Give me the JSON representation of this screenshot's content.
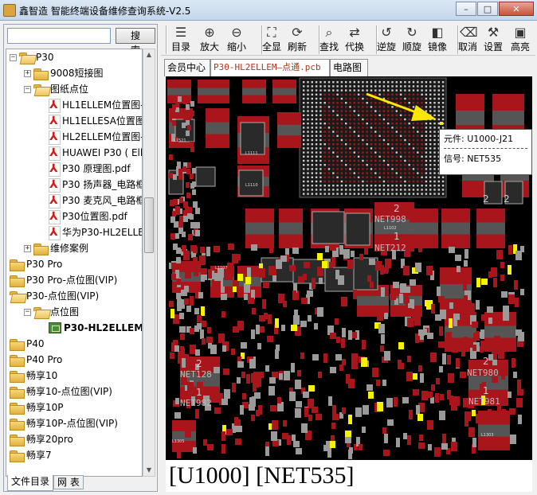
{
  "window": {
    "title": "鑫智造 智能终端设备维修查询系统-V2.5",
    "minimize_glyph": "–",
    "maximize_glyph": "□",
    "close_glyph": "✕"
  },
  "sidebar": {
    "search_placeholder": "",
    "search_label": "搜 索",
    "tree": [
      {
        "label": "P30",
        "icon": "folder-open-icon",
        "expander": "−",
        "depth": 0
      },
      {
        "label": "9008短接图",
        "icon": "folder-icon",
        "expander": "+",
        "depth": 1
      },
      {
        "label": "图纸点位",
        "icon": "folder-open-icon",
        "expander": "−",
        "depth": 1
      },
      {
        "label": "HL1ELLEM位置图-",
        "icon": "pdf-icon",
        "depth": 2
      },
      {
        "label": "HL1ELLESA位置图",
        "icon": "pdf-icon",
        "depth": 2
      },
      {
        "label": "HL2ELLEM位置图-",
        "icon": "pdf-icon",
        "depth": 2
      },
      {
        "label": "HUAWEI P30 ( Ell",
        "icon": "pdf-icon",
        "depth": 2
      },
      {
        "label": "P30 原理图.pdf",
        "icon": "pdf-icon",
        "depth": 2
      },
      {
        "label": "P30 扬声器_电路框",
        "icon": "pdf-icon",
        "depth": 2
      },
      {
        "label": "P30 麦克风_电路框",
        "icon": "pdf-icon",
        "depth": 2
      },
      {
        "label": "P30位置图.pdf",
        "icon": "pdf-icon",
        "depth": 2
      },
      {
        "label": "华为P30-HL2ELLEI",
        "icon": "pdf-icon",
        "depth": 2
      },
      {
        "label": "维修案例",
        "icon": "folder-icon",
        "expander": "+",
        "depth": 1
      },
      {
        "label": "P30 Pro",
        "icon": "folder-icon",
        "depth": 0
      },
      {
        "label": "P30 Pro-点位图(VIP)",
        "icon": "folder-icon",
        "depth": 0
      },
      {
        "label": "P30-点位图(VIP)",
        "icon": "folder-open-icon",
        "depth": 0
      },
      {
        "label": "点位图",
        "icon": "folder-open-icon",
        "expander": "−",
        "depth": 1
      },
      {
        "label": "P30-HL2ELLEM—",
        "icon": "pcb-icon",
        "depth": 2,
        "selected": true
      },
      {
        "label": "P40",
        "icon": "folder-icon",
        "depth": 0
      },
      {
        "label": "P40 Pro",
        "icon": "folder-icon",
        "depth": 0
      },
      {
        "label": "畅享10",
        "icon": "folder-icon",
        "depth": 0
      },
      {
        "label": "畅享10-点位图(VIP)",
        "icon": "folder-icon",
        "depth": 0
      },
      {
        "label": "畅享10P",
        "icon": "folder-icon",
        "depth": 0
      },
      {
        "label": "畅享10P-点位图(VIP)",
        "icon": "folder-icon",
        "depth": 0
      },
      {
        "label": "畅享20pro",
        "icon": "folder-icon",
        "depth": 0
      },
      {
        "label": "畅享7",
        "icon": "folder-icon",
        "depth": 0
      }
    ],
    "bottom_tabs": [
      "文件目录",
      "网 表"
    ]
  },
  "toolbar": {
    "tools": [
      {
        "label": "目录",
        "icon": "list-icon",
        "glyph": "☰"
      },
      {
        "label": "放大",
        "icon": "zoom-in-icon",
        "glyph": "⊕"
      },
      {
        "label": "缩小",
        "icon": "zoom-out-icon",
        "glyph": "⊖"
      },
      {
        "label": "全显",
        "icon": "fit-all-icon",
        "glyph": "⛶"
      },
      {
        "label": "刷新",
        "icon": "refresh-icon",
        "glyph": "⟳"
      },
      {
        "label": "查找",
        "icon": "search-icon",
        "glyph": "⌕"
      },
      {
        "label": "代换",
        "icon": "swap-icon",
        "glyph": "⇄"
      },
      {
        "label": "逆旋",
        "icon": "rotate-ccw-icon",
        "glyph": "↺"
      },
      {
        "label": "顺旋",
        "icon": "rotate-cw-icon",
        "glyph": "↻"
      },
      {
        "label": "镜像",
        "icon": "mirror-icon",
        "glyph": "◧"
      },
      {
        "label": "取消",
        "icon": "clear-icon",
        "glyph": "⌫"
      },
      {
        "label": "设置",
        "icon": "settings-icon",
        "glyph": "⚒"
      },
      {
        "label": "高亮",
        "icon": "highlight-icon",
        "glyph": "▣"
      }
    ]
  },
  "tabs": [
    {
      "label": "会员中心",
      "active": false
    },
    {
      "label": "P30-HL2ELLEM—点通.pcb",
      "active": true
    },
    {
      "label": "电路图",
      "active": false
    }
  ],
  "tooltip": {
    "component_label": "元件: U1000-J21",
    "signal_label": "信号: NET535"
  },
  "pcb_labels": {
    "net_a": "NET998",
    "net_b": "NET212",
    "net_c": "NET128",
    "net_d": "NET982",
    "net_e": "NET980",
    "net_f": "NET981",
    "pin_1a": "1",
    "pin_2a": "2",
    "pin_1b": "1",
    "pin_2b": "2",
    "pin_1c": "1",
    "pin_2c": "2",
    "pin_2d": "2",
    "pin_2e": "2",
    "ref_l1521": "L1521",
    "ref_l1111": "L1111",
    "ref_l1110": "L1110",
    "ref_l1102": "L1102",
    "ref_l1107": "L1107",
    "ref_l1305": "L1305",
    "ref_l1303": "L1303"
  },
  "status": {
    "text": "[U1000] [NET535]"
  },
  "colors": {
    "pad_red": "#a8151a",
    "pad_gray": "#9a9a9a",
    "highlight_yellow": "#f7f200",
    "board_bg": "#000000",
    "arrow_yellow": "#ffe800"
  }
}
